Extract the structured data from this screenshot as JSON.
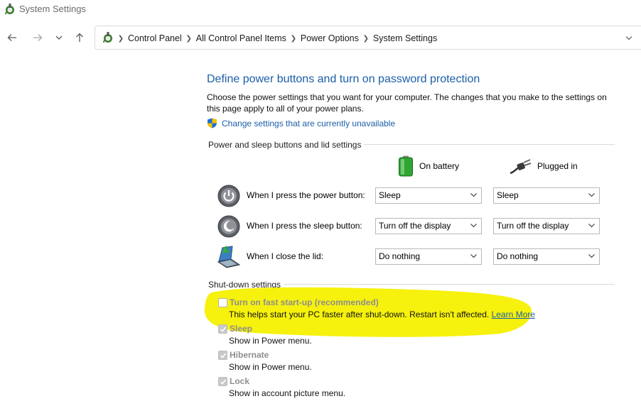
{
  "window": {
    "title": "System Settings"
  },
  "nav": {
    "breadcrumbs": [
      "Control Panel",
      "All Control Panel Items",
      "Power Options",
      "System Settings"
    ]
  },
  "page": {
    "title": "Define power buttons and turn on password protection",
    "intro": "Choose the power settings that you want for your computer. The changes that you make to the settings on this page apply to all of your power plans.",
    "change_link": "Change settings that are currently unavailable"
  },
  "power_section": {
    "heading": "Power and sleep buttons and lid settings",
    "col_battery": "On battery",
    "col_plugged": "Plugged in",
    "rows": [
      {
        "label": "When I press the power button:",
        "battery": "Sleep",
        "plugged": "Sleep"
      },
      {
        "label": "When I press the sleep button:",
        "battery": "Turn off the display",
        "plugged": "Turn off the display"
      },
      {
        "label": "When I close the lid:",
        "battery": "Do nothing",
        "plugged": "Do nothing"
      }
    ]
  },
  "shutdown_section": {
    "heading": "Shut-down settings",
    "items": [
      {
        "title": "Turn on fast start-up (recommended)",
        "desc": "This helps start your PC faster after shut-down. Restart isn't affected.",
        "link": "Learn More",
        "checked": false
      },
      {
        "title": "Sleep",
        "desc": "Show in Power menu.",
        "checked": true
      },
      {
        "title": "Hibernate",
        "desc": "Show in Power menu.",
        "checked": true
      },
      {
        "title": "Lock",
        "desc": "Show in account picture menu.",
        "checked": true
      }
    ]
  },
  "colors": {
    "link": "#1c5ea8",
    "highlight": "#f5f000"
  }
}
